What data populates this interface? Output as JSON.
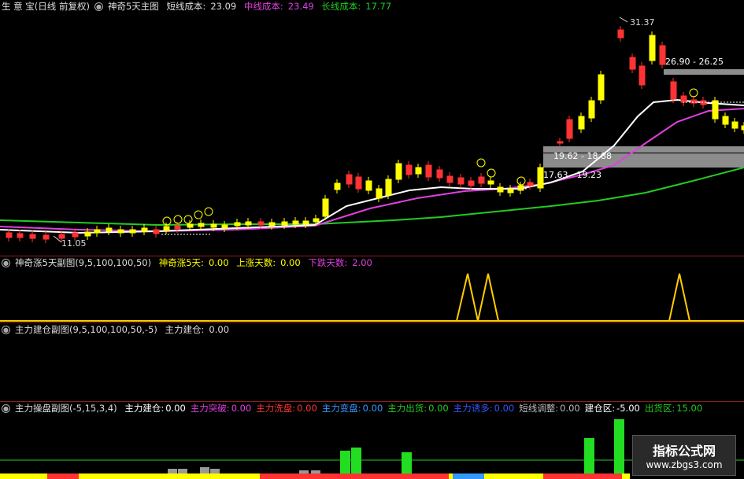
{
  "main": {
    "prefix": "生 意 宝(日线 前复权)",
    "name": "神奇5天主图",
    "short_label": "短线成本:",
    "short_value": "23.09",
    "mid_label": "中线成本:",
    "mid_value": "23.49",
    "long_label": "长线成本:",
    "long_value": "17.77",
    "price_high": "31.37",
    "price_low": "11.05",
    "zone_upper": "26.90 - 26.25",
    "zone_mid": "19.62 - 18.88",
    "zone_low": "17.63 - 19.23",
    "markers": [
      "1",
      "2",
      "3",
      "4",
      "5"
    ],
    "colors": {
      "short": "#ffffff",
      "mid": "#e040e0",
      "long": "#22cc22",
      "up": "#ffff00",
      "down": "#ff3333"
    }
  },
  "sub1": {
    "name": "神奇涨5天副图(9,5,100,100,50)",
    "a_label": "神奇涨5天:",
    "a_value": "0.00",
    "b_label": "上涨天数:",
    "b_value": "0.00",
    "c_label": "下跌天数:",
    "c_value": "2.00"
  },
  "sub2": {
    "name": "主力建仓副图(9,5,100,100,50,-5)",
    "a_label": "主力建仓:",
    "a_value": "0.00"
  },
  "sub3": {
    "name": "主力操盘副图(-5,15,3,4)",
    "items": [
      {
        "label": "主力建仓:",
        "value": "0.00",
        "color": "#ffffff"
      },
      {
        "label": "主力突破:",
        "value": "0.00",
        "color": "#e040e0"
      },
      {
        "label": "主力洗盘:",
        "value": "0.00",
        "color": "#ff3333"
      },
      {
        "label": "主力变盘:",
        "value": "0.00",
        "color": "#3399ff"
      },
      {
        "label": "主力出货:",
        "value": "0.00",
        "color": "#22cc22"
      },
      {
        "label": "主力诱多:",
        "value": "0.00",
        "color": "#3355ff"
      },
      {
        "label": "短线调整:",
        "value": "0.00",
        "color": "#bbbbbb"
      },
      {
        "label": "建仓区:",
        "value": "-5.00",
        "color": "#ffffff"
      },
      {
        "label": "出货区:",
        "value": "15.00",
        "color": "#22cc22"
      }
    ]
  },
  "watermark": {
    "title": "指标公式网",
    "url": "www.zbgs3.com"
  }
}
